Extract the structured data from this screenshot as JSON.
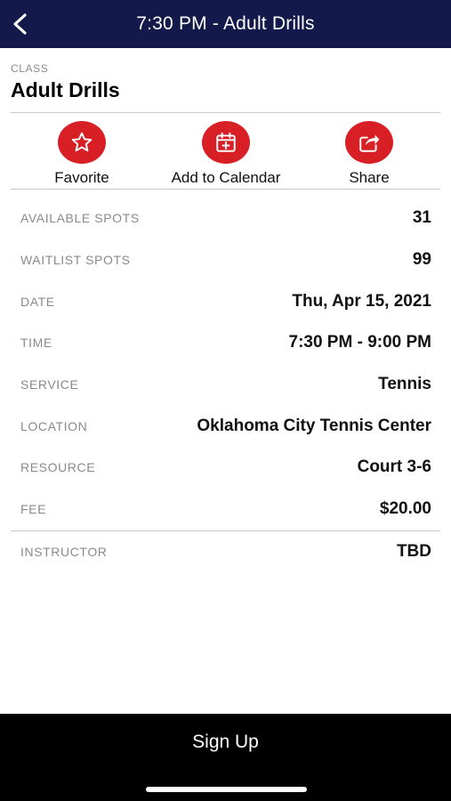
{
  "header": {
    "title": "7:30 PM - Adult Drills",
    "background": "#13194a",
    "back_icon": "chevron-left-icon"
  },
  "class_info": {
    "label": "CLASS",
    "name": "Adult Drills"
  },
  "actions": {
    "accent": "#d91f26",
    "favorite": {
      "label": "Favorite",
      "icon": "star-icon"
    },
    "calendar": {
      "label": "Add to Calendar",
      "icon": "calendar-add-icon"
    },
    "share": {
      "label": "Share",
      "icon": "share-icon"
    }
  },
  "details": [
    {
      "key": "AVAILABLE SPOTS",
      "value": "31"
    },
    {
      "key": "WAITLIST SPOTS",
      "value": "99"
    },
    {
      "key": "DATE",
      "value": "Thu, Apr 15, 2021"
    },
    {
      "key": "TIME",
      "value": "7:30 PM - 9:00 PM"
    },
    {
      "key": "SERVICE",
      "value": "Tennis"
    },
    {
      "key": "LOCATION",
      "value": "Oklahoma City Tennis Center"
    },
    {
      "key": "RESOURCE",
      "value": "Court 3-6"
    },
    {
      "key": "FEE",
      "value": "$20.00"
    },
    {
      "key": "INSTRUCTOR",
      "value": "TBD"
    }
  ],
  "footer": {
    "signup_label": "Sign Up"
  }
}
